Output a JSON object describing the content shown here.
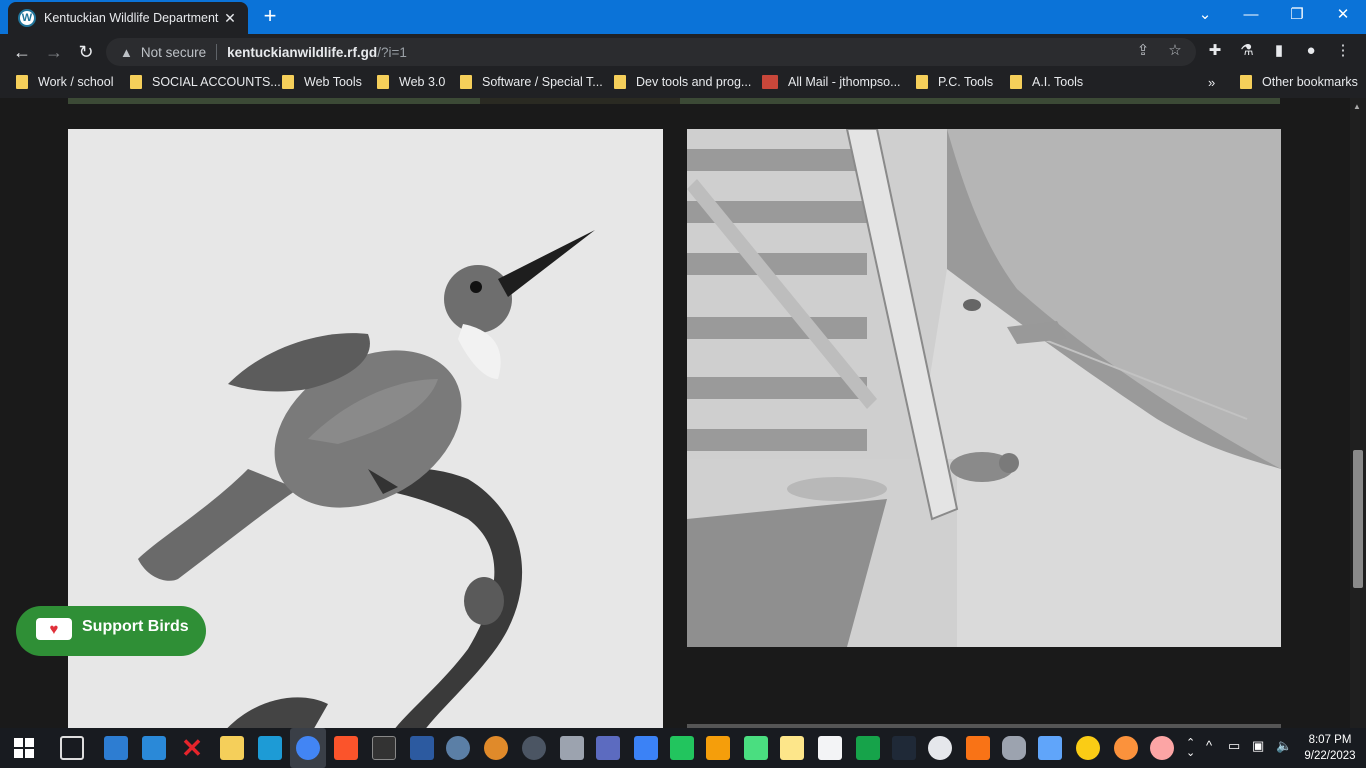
{
  "browser": {
    "tab_title": "Kentuckian Wildlife Department -",
    "tab_icon": "wordpress-icon",
    "new_tab": "+",
    "security_label": "Not secure",
    "url_host": "kentuckianwildlife.rf.gd",
    "url_path": "/?i=1"
  },
  "bookmarks": [
    {
      "label": "Work / school"
    },
    {
      "label": "SOCIAL ACCOUNTS..."
    },
    {
      "label": "Web Tools"
    },
    {
      "label": "Web 3.0"
    },
    {
      "label": "Software / Special T..."
    },
    {
      "label": "Dev tools and prog..."
    },
    {
      "label": "All Mail - jthompso..."
    },
    {
      "label": "P.C. Tools"
    },
    {
      "label": "A.I. Tools"
    }
  ],
  "other_bookmarks": "Other bookmarks",
  "page": {
    "support_button": "Support Birds"
  },
  "taskbar": {
    "time": "8:07 PM",
    "date": "9/22/2023"
  },
  "colors": {
    "titlebar": "#0b73d8",
    "chrome_dark": "#202124",
    "support_green": "#2f8f36",
    "page_bg": "#1a1a1a"
  }
}
